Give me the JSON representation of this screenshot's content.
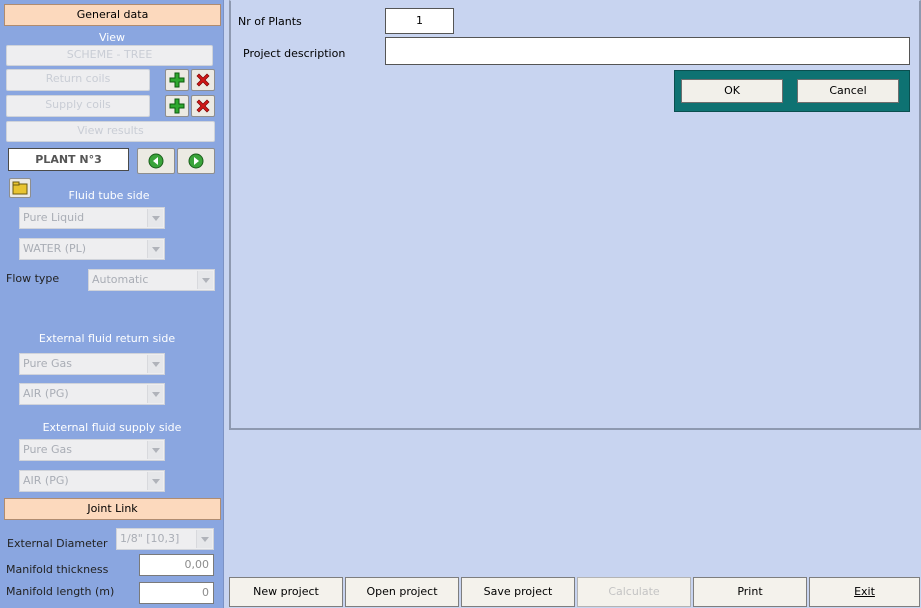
{
  "sidebar": {
    "general_data": "General data",
    "view_label": "View",
    "scheme_tree": "SCHEME - TREE",
    "return_coils": "Return coils",
    "supply_coils": "Supply coils",
    "view_results": "View results",
    "plant_label": "PLANT N°3",
    "fluid_tube_side": "Fluid tube side",
    "fluid_type": "Pure Liquid",
    "fluid_name": "WATER (PL)",
    "flow_type_label": "Flow type",
    "flow_type_value": "Automatic",
    "ext_return_side": "External fluid return side",
    "ext_return_type": "Pure Gas",
    "ext_return_name": "AIR (PG)",
    "ext_supply_side": "External fluid supply side",
    "ext_supply_type": "Pure Gas",
    "ext_supply_name": "AIR (PG)",
    "joint_link": "Joint Link",
    "ext_diameter_label": "External Diameter",
    "ext_diameter_value": "1/8\" [10,3]",
    "manifold_thickness_label": "Manifold thickness",
    "manifold_thickness_value": "0,00",
    "manifold_length_label": "Manifold length (m)",
    "manifold_length_value": "0"
  },
  "main": {
    "nr_plants_label": "Nr of Plants",
    "nr_plants_value": "1",
    "project_description_label": "Project description",
    "project_description_value": "",
    "ok": "OK",
    "cancel": "Cancel"
  },
  "bottom": {
    "new_project": "New project",
    "open_project": "Open project",
    "save_project": "Save project",
    "calculate": "Calculate",
    "print": "Print",
    "exit": "Exit"
  },
  "colors": {
    "sidebar_bg": "#8aa6e0",
    "main_bg": "#c8d4f0",
    "header_peach": "#fcd9bd",
    "dialog_teal": "#0e7272"
  }
}
